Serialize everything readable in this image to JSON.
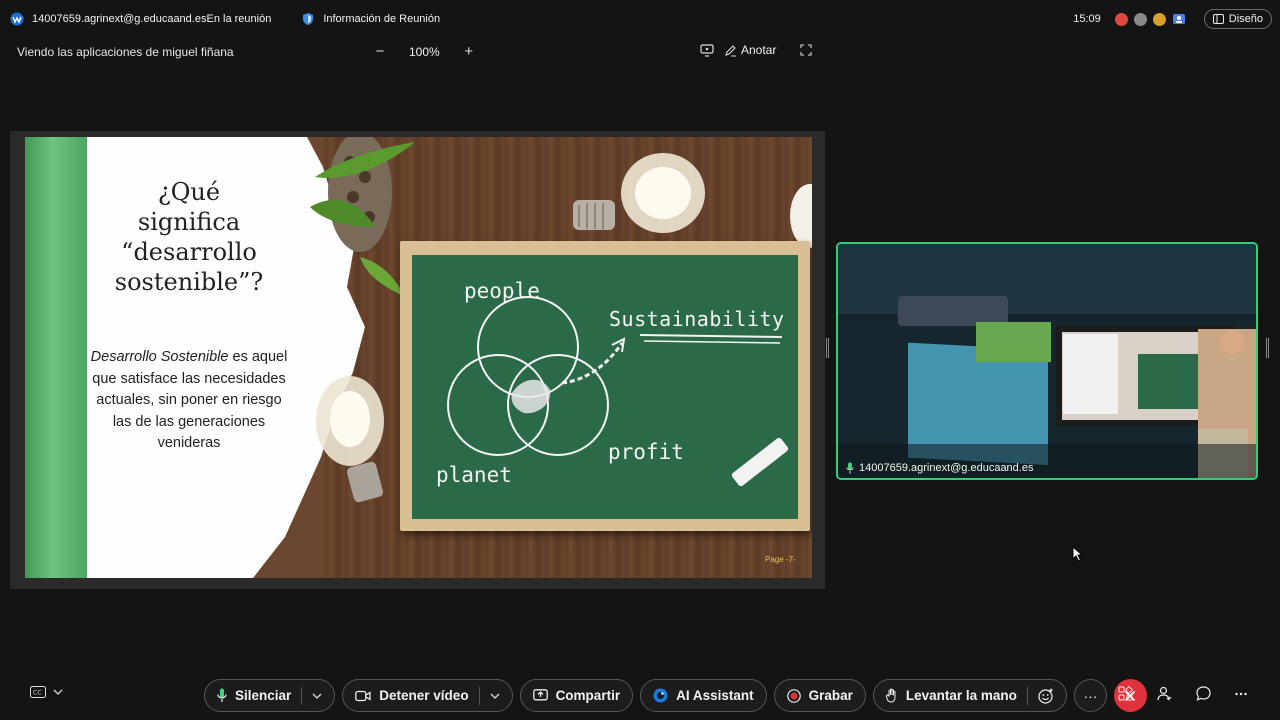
{
  "topbar": {
    "meeting_id": "14007659.agrinext@g.educaand.es",
    "status": "En la reunión",
    "info_label": "Información de Reunión",
    "time": "15:09",
    "layout_label": "Diseño",
    "status_dots": [
      "#e0483f",
      "#8a8a8a",
      "#d9a02b",
      "#4f7ee8"
    ]
  },
  "sharebar": {
    "title": "Viendo las aplicaciones de miguel fiñana",
    "zoom_level": "100%",
    "annotate_label": "Anotar"
  },
  "slide": {
    "title_lines": [
      "¿Qué",
      "significa",
      "“desarrollo",
      "sostenible”?"
    ],
    "body_italic": "Desarrollo Sostenible",
    "body_rest": " es aquel que satisface las necesidades actuales, sin poner en riesgo las de las generaciones venideras",
    "chalk": {
      "people": "people",
      "sustainability": "Sustainability",
      "profit": "profit",
      "planet": "planet"
    },
    "page": "Page -7-"
  },
  "video": {
    "participant": "14007659.agrinext@g.educaand.es"
  },
  "controls": {
    "mute": "Silenciar",
    "stop_video": "Detener vídeo",
    "share": "Compartir",
    "ai_assistant": "AI Assistant",
    "record": "Grabar",
    "raise_hand": "Levantar la mano",
    "more": "···",
    "end_color": "#e0323a"
  }
}
